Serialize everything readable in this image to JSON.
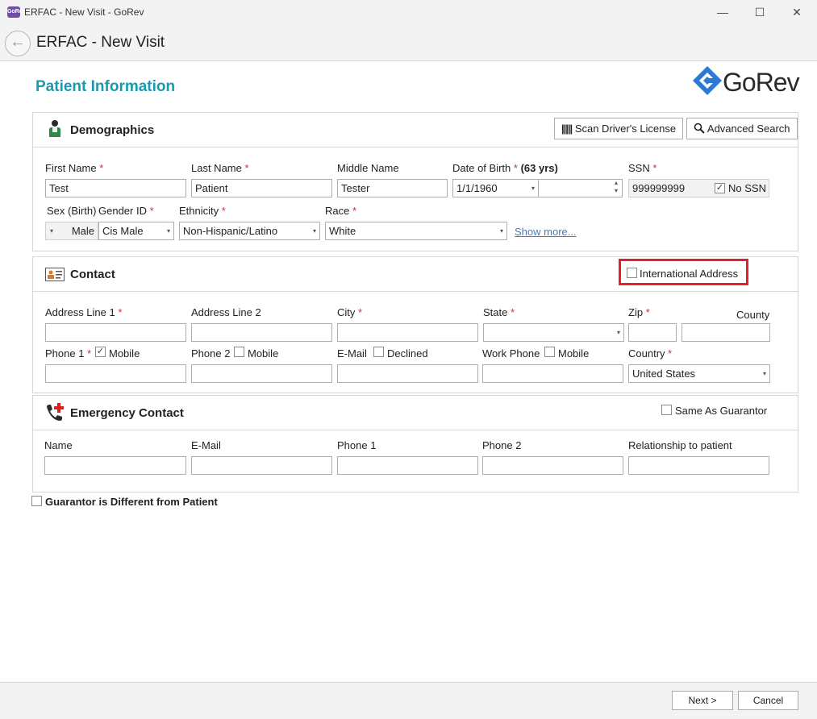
{
  "window": {
    "title": "ERFAC - New Visit - GoRev",
    "app_icon_text": "GoRev",
    "controls": {
      "minimize": "—",
      "maximize": "☐",
      "close": "✕"
    }
  },
  "header": {
    "back": "←",
    "title": "ERFAC - New Visit"
  },
  "page": {
    "heading": "Patient Information",
    "logo_text": "GoRev"
  },
  "demographics": {
    "title": "Demographics",
    "scan_button": "Scan Driver's License",
    "search_button": "Advanced Search",
    "first_name_label": "First Name",
    "first_name": "Test",
    "last_name_label": "Last Name",
    "last_name": "Patient",
    "middle_name_label": "Middle Name",
    "middle_name": "Tester",
    "dob_label": "Date of Birth",
    "dob_age": "(63 yrs)",
    "dob": "1/1/1960",
    "ssn_label": "SSN",
    "ssn": "999999999",
    "no_ssn_label": "No SSN",
    "sex_label": "Sex (Birth)",
    "sex": "Male",
    "gender_label": "Gender ID",
    "gender": "Cis Male",
    "ethnicity_label": "Ethnicity",
    "ethnicity": "Non-Hispanic/Latino",
    "race_label": "Race",
    "race": "White",
    "show_more": "Show more..."
  },
  "contact": {
    "title": "Contact",
    "international_label": "International Address",
    "address1_label": "Address Line 1",
    "address2_label": "Address Line 2",
    "city_label": "City",
    "state_label": "State",
    "zip_label": "Zip",
    "county_label": "County",
    "phone1_label": "Phone 1",
    "mobile_label": "Mobile",
    "phone2_label": "Phone 2",
    "email_label": "E-Mail",
    "declined_label": "Declined",
    "work_phone_label": "Work Phone",
    "country_label": "Country",
    "country": "United States"
  },
  "emergency": {
    "title": "Emergency Contact",
    "same_as_guarantor": "Same As Guarantor",
    "name_label": "Name",
    "email_label": "E-Mail",
    "phone1_label": "Phone 1",
    "phone2_label": "Phone 2",
    "relationship_label": "Relationship to patient"
  },
  "guarantor_different": "Guarantor is Different from Patient",
  "footer": {
    "next": "Next >",
    "cancel": "Cancel"
  },
  "common": {
    "required": "*",
    "check": "✓",
    "dd_arrow": "▾",
    "spin_up": "▴",
    "spin_down": "▾"
  },
  "colors": {
    "accent": "#1a9ab0",
    "highlight": "#e0202a",
    "required": "#d03030",
    "logo_blue": "#2b7bd6"
  }
}
